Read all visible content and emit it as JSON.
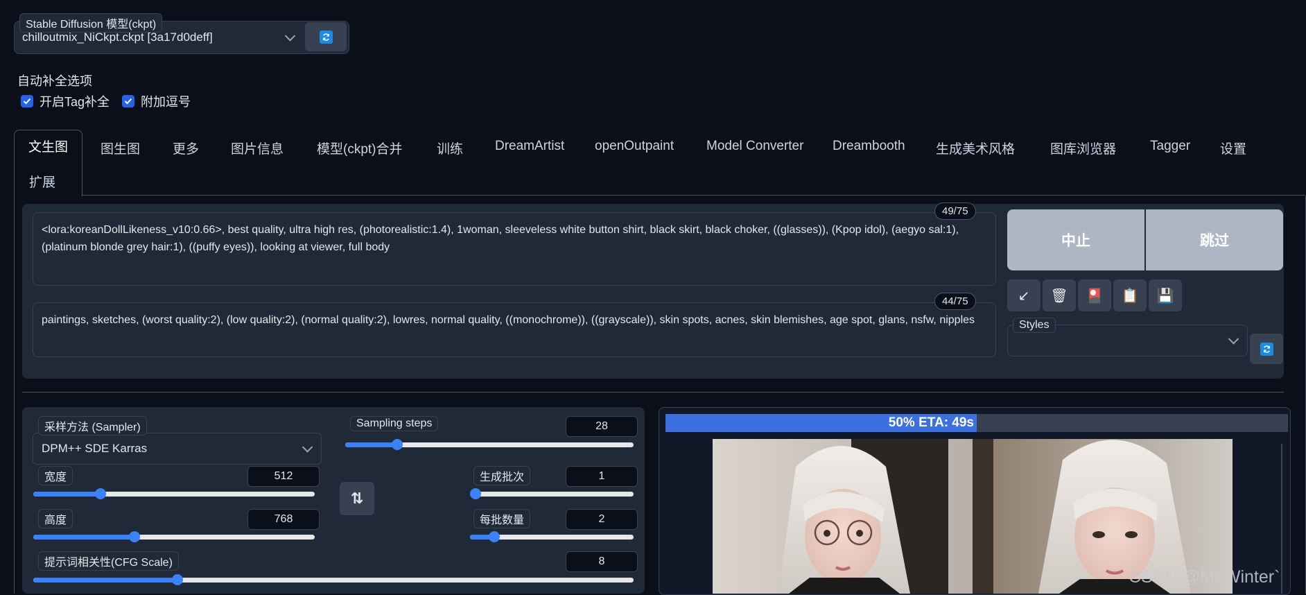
{
  "model": {
    "label": "Stable Diffusion 模型(ckpt)",
    "selected": "chilloutmix_NiCkpt.ckpt [3a17d0deff]"
  },
  "autocomplete": {
    "title": "自动补全选项",
    "options": [
      {
        "label": "开启Tag补全",
        "checked": true
      },
      {
        "label": "附加逗号",
        "checked": true
      }
    ]
  },
  "tabs": [
    "文生图",
    "图生图",
    "更多",
    "图片信息",
    "模型(ckpt)合并",
    "训练",
    "DreamArtist",
    "openOutpaint",
    "Model Converter",
    "Dreambooth",
    "生成美术风格",
    "图库浏览器",
    "Tagger",
    "设置",
    "扩展"
  ],
  "active_tab": "文生图",
  "prompt": {
    "text": "<lora:koreanDollLikeness_v10:0.66>, best quality, ultra high res, (photorealistic:1.4), 1woman, sleeveless white button shirt, black skirt, black choker, ((glasses)), (Kpop idol), (aegyo sal:1), (platinum blonde grey hair:1), ((puffy eyes)), looking at viewer, full body",
    "token_count": "49/75"
  },
  "negative_prompt": {
    "text": "paintings, sketches, (worst quality:2), (low quality:2), (normal quality:2), lowres, normal quality, ((monochrome)), ((grayscale)), skin spots, acnes, skin blemishes, age spot, glans, nsfw, nipples",
    "token_count": "44/75"
  },
  "actions": {
    "interrupt": "中止",
    "skip": "跳过"
  },
  "tools": [
    {
      "icon": "arrow-down-left-icon",
      "glyph": "↙"
    },
    {
      "icon": "trash-icon",
      "glyph": "🗑"
    },
    {
      "icon": "red-card-icon",
      "glyph": "🎴"
    },
    {
      "icon": "clipboard-icon",
      "glyph": "📋"
    },
    {
      "icon": "save-icon",
      "glyph": "💾"
    }
  ],
  "styles": {
    "label": "Styles",
    "selected": ""
  },
  "sampler": {
    "label": "采样方法 (Sampler)",
    "selected": "DPM++ SDE Karras"
  },
  "sampling_steps": {
    "label": "Sampling steps",
    "value": "28",
    "min": 1,
    "max": 150,
    "fraction": 0.18
  },
  "width": {
    "label": "宽度",
    "value": "512",
    "fraction": 0.24
  },
  "height": {
    "label": "高度",
    "value": "768",
    "fraction": 0.36
  },
  "batch_count": {
    "label": "生成批次",
    "value": "1",
    "fraction": 0.0
  },
  "batch_size": {
    "label": "每批数量",
    "value": "2",
    "fraction": 0.15
  },
  "cfg_scale": {
    "label": "提示词相关性(CFG Scale)",
    "value": "8",
    "fraction": 0.24
  },
  "swap_icon": "⇅",
  "progress": {
    "text": "50% ETA: 49s",
    "percent": 50
  },
  "watermark": "CSDN @Mr.Winter`",
  "colors": {
    "accent": "#3b82f6",
    "background": "#0b0f19",
    "panel": "#1f2937"
  }
}
